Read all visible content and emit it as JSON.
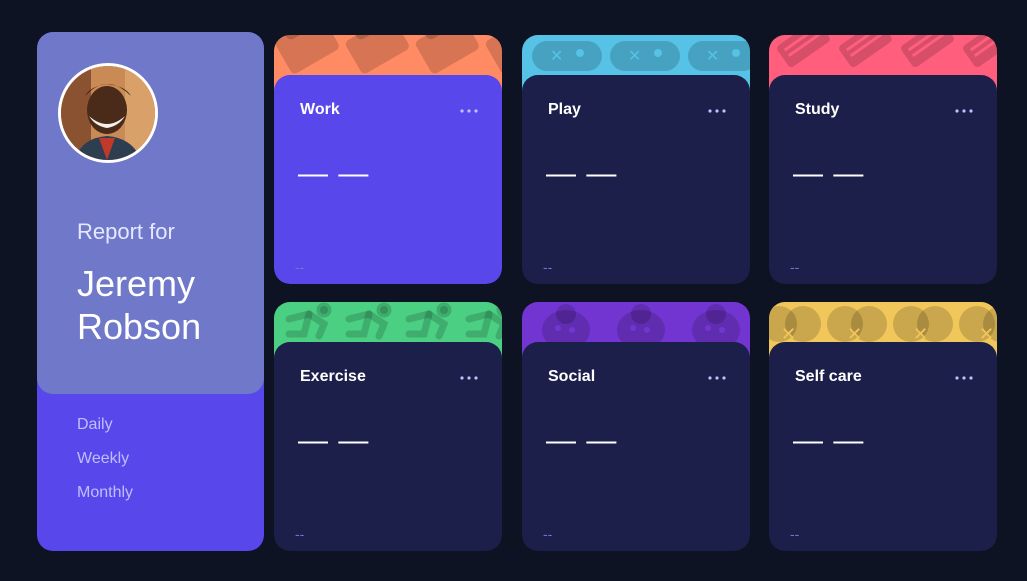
{
  "profile": {
    "report_label": "Report for",
    "name": "Jeremy Robson",
    "periods": [
      "Daily",
      "Weekly",
      "Monthly"
    ]
  },
  "activities": [
    {
      "title": "Work",
      "current": "— —",
      "previous": "--",
      "color": "#ff8b64",
      "icon": "briefcase-icon",
      "active": true
    },
    {
      "title": "Play",
      "current": "— —",
      "previous": "--",
      "color": "#55c2e6",
      "icon": "gamepad-icon",
      "active": false
    },
    {
      "title": "Study",
      "current": "— —",
      "previous": "--",
      "color": "#ff5e7d",
      "icon": "book-icon",
      "active": false
    },
    {
      "title": "Exercise",
      "current": "— —",
      "previous": "--",
      "color": "#4bcf82",
      "icon": "runner-icon",
      "active": false
    },
    {
      "title": "Social",
      "current": "— —",
      "previous": "--",
      "color": "#7335d2",
      "icon": "social-icon",
      "active": false
    },
    {
      "title": "Self care",
      "current": "— —",
      "previous": "--",
      "color": "#f1c75b",
      "icon": "heart-icon",
      "active": false
    }
  ],
  "colors": {
    "background": "#0e1323",
    "accent": "#5847eb",
    "card": "#1c1f4a",
    "profile_top": "#7078c9"
  }
}
